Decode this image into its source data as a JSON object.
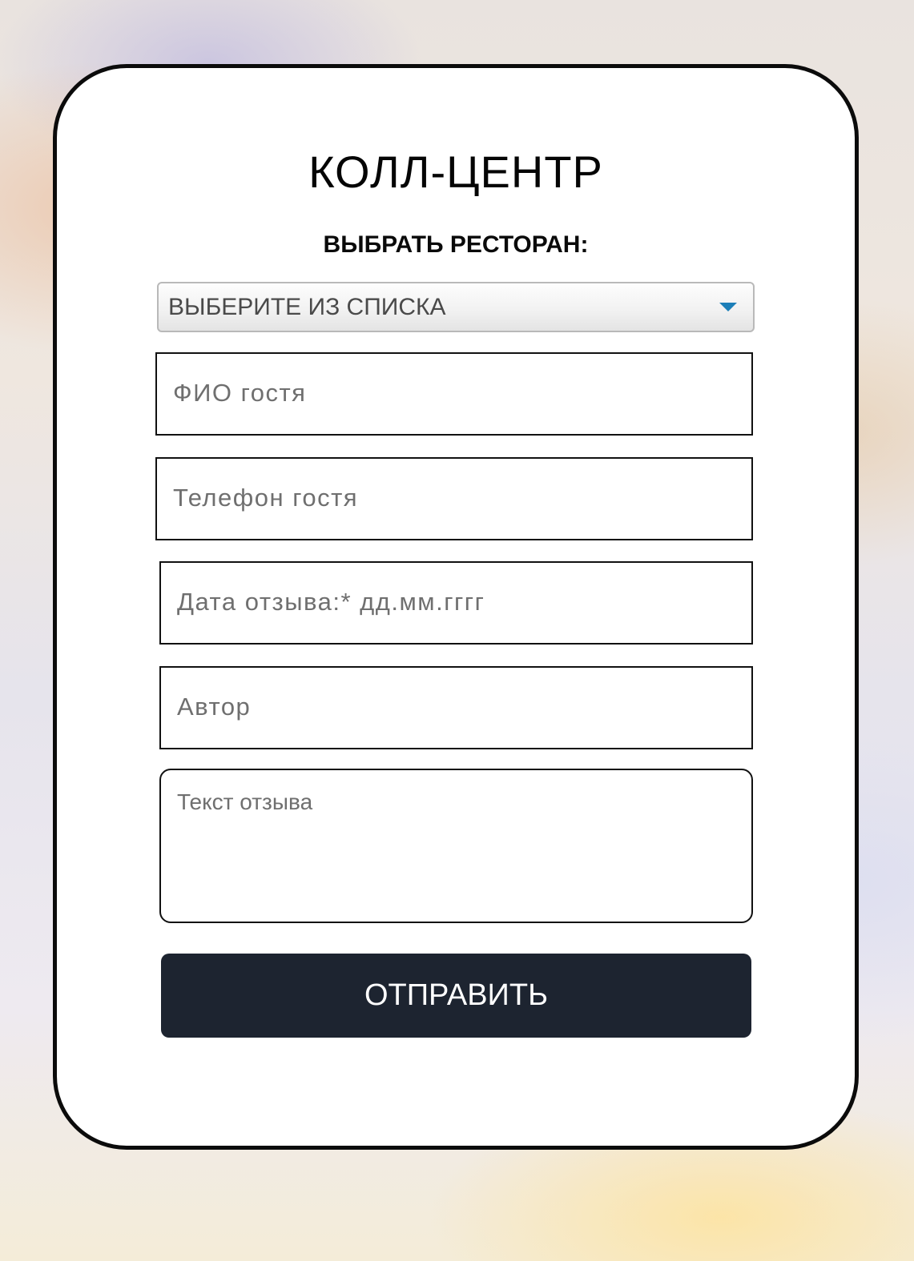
{
  "form": {
    "title": "КОЛЛ-ЦЕНТР",
    "restaurant_label": "ВЫБРАТЬ РЕСТОРАН:",
    "restaurant_select": {
      "selected": "ВЫБЕРИТЕ ИЗ СПИСКА",
      "icon": "chevron-down-icon"
    },
    "fields": [
      {
        "placeholder": "ФИО гостя"
      },
      {
        "placeholder": "Телефон гостя"
      },
      {
        "placeholder": "Дата отзыва:* дд.мм.гггг"
      },
      {
        "placeholder": "Автор"
      }
    ],
    "review_text": {
      "placeholder": "Текст отзыва"
    },
    "submit_label": "ОТПРАВИТЬ"
  },
  "colors": {
    "card_background": "#ffffff",
    "card_border": "#0b0b0b",
    "button_background": "#1d2430",
    "select_arrow": "#1d7fb8",
    "placeholder_text": "#6f6f6f"
  }
}
